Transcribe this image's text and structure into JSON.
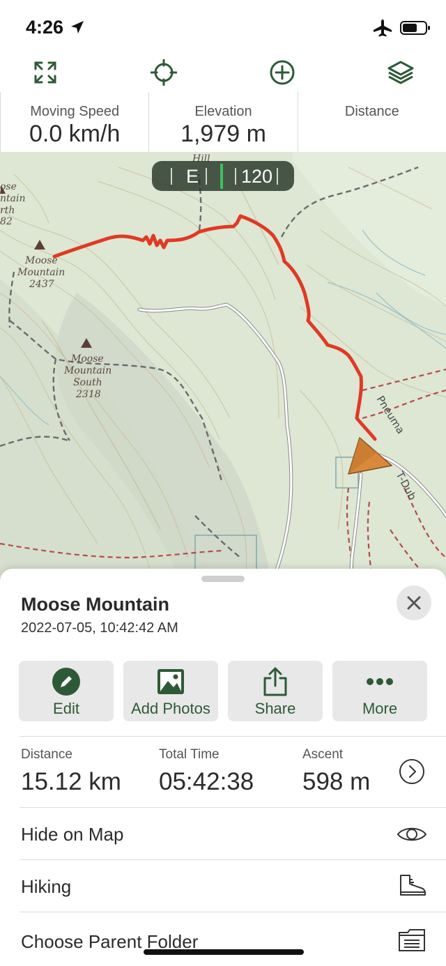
{
  "status_bar": {
    "time": "4:26"
  },
  "toolbar": {
    "icons": [
      "expand-icon",
      "locate-crosshair-icon",
      "add-circle-icon",
      "layers-icon"
    ]
  },
  "stats": {
    "moving_speed": {
      "label": "Moving Speed",
      "value": "0.0 km/h"
    },
    "elevation": {
      "label": "Elevation",
      "value": "1,979 m"
    },
    "distance": {
      "label": "Distance",
      "value": ""
    }
  },
  "map": {
    "compass": {
      "direction": "E",
      "heading": "120"
    },
    "labels": {
      "hill": "Hill",
      "moose_north_1": "ose",
      "moose_north_2": "ntain",
      "moose_north_3": "rth",
      "moose_north_4": "82",
      "moose_mountain_1": "Moose",
      "moose_mountain_2": "Mountain",
      "moose_mountain_elev": "2437",
      "moose_south_1": "Moose",
      "moose_south_2": "Mountain",
      "moose_south_3": "South",
      "moose_south_elev": "2318",
      "trail_pneuma": "Pneuma",
      "trail_tdub": "T-Dub"
    },
    "colors": {
      "track": "#e03a24",
      "trail": "#6b6b6b",
      "road": "#ffffff",
      "boundary": "#b54b4b"
    }
  },
  "sheet": {
    "title": "Moose Mountain",
    "datetime": "2022-07-05, 10:42:42 AM",
    "actions": [
      {
        "label": "Edit",
        "icon": "pencil-icon"
      },
      {
        "label": "Add Photos",
        "icon": "photo-icon"
      },
      {
        "label": "Share",
        "icon": "share-icon"
      },
      {
        "label": "More",
        "icon": "more-dots-icon"
      }
    ],
    "metrics": [
      {
        "label": "Distance",
        "value": "15.12 km"
      },
      {
        "label": "Total Time",
        "value": "05:42:38"
      },
      {
        "label": "Ascent",
        "value": "598 m"
      }
    ],
    "rows": [
      {
        "label": "Hide on Map",
        "icon": "eye-icon"
      },
      {
        "label": "Hiking",
        "icon": "hiking-boot-icon"
      },
      {
        "label": "Choose Parent Folder",
        "icon": "folder-icon"
      }
    ]
  },
  "accent_color": "#2d5a36"
}
